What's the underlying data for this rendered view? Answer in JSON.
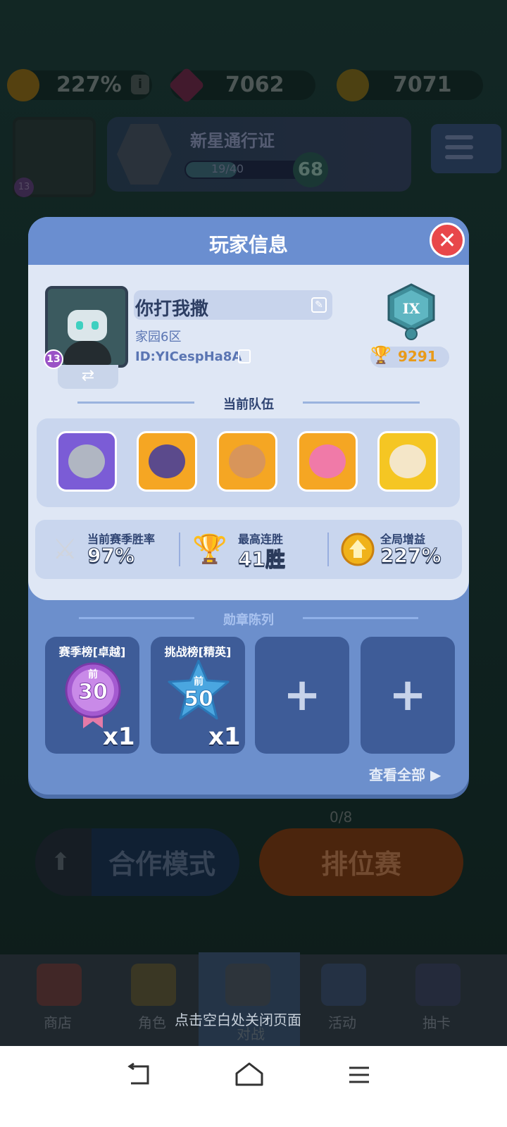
{
  "background": {
    "resources": {
      "boost": "227%",
      "gems": "7062",
      "coins": "7071"
    },
    "pass": {
      "title": "新星通行证",
      "progress": "19/40",
      "progress_fraction": 0.475,
      "level": "68"
    },
    "player_level": "13",
    "modes": {
      "coop": "合作模式",
      "ranked": "排位赛",
      "ranked_count": "0/8"
    },
    "bottom_nav": [
      "商店",
      "角色",
      "对战",
      "活动",
      "抽卡"
    ],
    "close_hint": "点击空白处关闭页面"
  },
  "modal": {
    "title": "玩家信息",
    "close_icon": "close-icon",
    "player": {
      "name": "你打我撒",
      "server": "家园6区",
      "id": "ID:YICespHa8A",
      "level": "13",
      "rank_emblem": "IX",
      "trophies": "9291"
    },
    "team": {
      "title": "当前队伍",
      "heroes": [
        {
          "name": "knight",
          "border": "#7b5cd6",
          "face": "#b0b6c2"
        },
        {
          "name": "dark-mage",
          "border": "#f5a623",
          "face": "#5b4a8c"
        },
        {
          "name": "samurai",
          "border": "#f5a623",
          "face": "#d8955a"
        },
        {
          "name": "pink-cat",
          "border": "#f5a623",
          "face": "#f07aa8"
        },
        {
          "name": "angel",
          "border": "#f5c623",
          "face": "#f4e6c8"
        }
      ]
    },
    "stats": [
      {
        "label": "当前赛季胜率",
        "value": "97%",
        "icon": "swords-icon"
      },
      {
        "label": "最高连胜",
        "value": "41胜",
        "icon": "trophy-icon"
      },
      {
        "label": "全局增益",
        "value": "227%",
        "icon": "boost-icon"
      }
    ],
    "medals": {
      "title": "勋章陈列",
      "items": [
        {
          "title": "赛季榜[卓越]",
          "badge_top": "前",
          "badge_num": "30",
          "count": "x1",
          "color": "#a45ad0"
        },
        {
          "title": "挑战榜[精英]",
          "badge_top": "前",
          "badge_num": "50",
          "count": "x1",
          "color": "#4aa6e0"
        }
      ],
      "empty_slot": "+",
      "view_all": "查看全部 ▶"
    }
  },
  "system_nav": [
    "back-icon",
    "home-icon",
    "menu-icon"
  ]
}
